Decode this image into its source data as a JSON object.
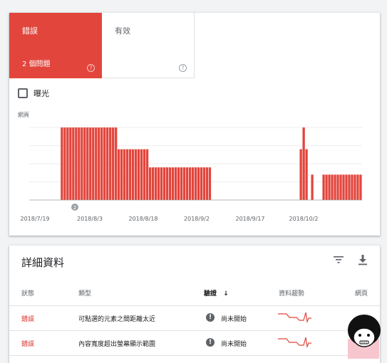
{
  "tiles": {
    "error": {
      "label": "錯誤",
      "count": "2 個問題",
      "help": "?"
    },
    "valid": {
      "label": "有效",
      "help": "?"
    }
  },
  "exposure": {
    "label": "曝光",
    "checked": false
  },
  "chart_data": {
    "type": "bar",
    "ylabel": "網頁",
    "x_tick_labels": [
      "2018/7/19",
      "2018/8/3",
      "2018/8/18",
      "2018/9/2",
      "2018/9/17",
      "2018/10/2"
    ],
    "annotation": "2",
    "values": [
      0,
      0,
      0,
      0,
      0,
      0,
      0,
      0,
      0,
      0,
      0,
      2,
      2,
      2,
      2,
      2,
      2,
      2,
      2,
      2,
      2,
      2,
      2,
      2,
      2,
      2,
      2,
      2,
      2,
      2,
      2,
      1.4,
      1.4,
      1.4,
      1.4,
      1.4,
      1.4,
      1.4,
      1.4,
      1.4,
      1.4,
      1.4,
      0.9,
      0.9,
      0.9,
      0.9,
      0.9,
      0.9,
      0.9,
      0.9,
      0.9,
      0.9,
      0.9,
      0.9,
      0.9,
      0.9,
      0.9,
      0.9,
      0.9,
      0.9,
      0.9,
      0.9,
      0.9,
      0.9,
      0,
      0,
      0,
      0,
      0,
      0,
      0,
      0,
      0,
      0,
      0,
      0,
      0,
      0,
      0,
      0,
      0,
      0,
      0,
      0,
      0,
      0,
      0,
      0,
      0,
      0,
      0,
      0,
      0,
      0,
      0,
      1.4,
      2,
      1.4,
      0,
      0.7,
      0,
      0,
      0,
      0.7,
      0.7,
      0.7,
      0.7,
      0.7,
      0.7,
      0.7,
      0.7,
      0.7,
      0.7,
      0.7,
      0.7,
      0.7,
      0.7
    ],
    "color": "#e2453c",
    "ylim": [
      0,
      2.1
    ]
  },
  "details": {
    "title": "詳細資料",
    "columns": [
      "狀態",
      "類型",
      "驗證",
      "資料趨勢",
      "網頁"
    ],
    "sort_arrow": "↓",
    "rows": [
      {
        "status": "錯誤",
        "type": "可點選的元素之間距離太近",
        "validation": "尚未開始"
      },
      {
        "status": "錯誤",
        "type": "內容寬度超出螢幕顯示範圍",
        "validation": "尚未開始"
      }
    ]
  },
  "icons": {
    "filter": "filter-icon",
    "download": "download-icon",
    "warning": "exclamation-icon"
  }
}
